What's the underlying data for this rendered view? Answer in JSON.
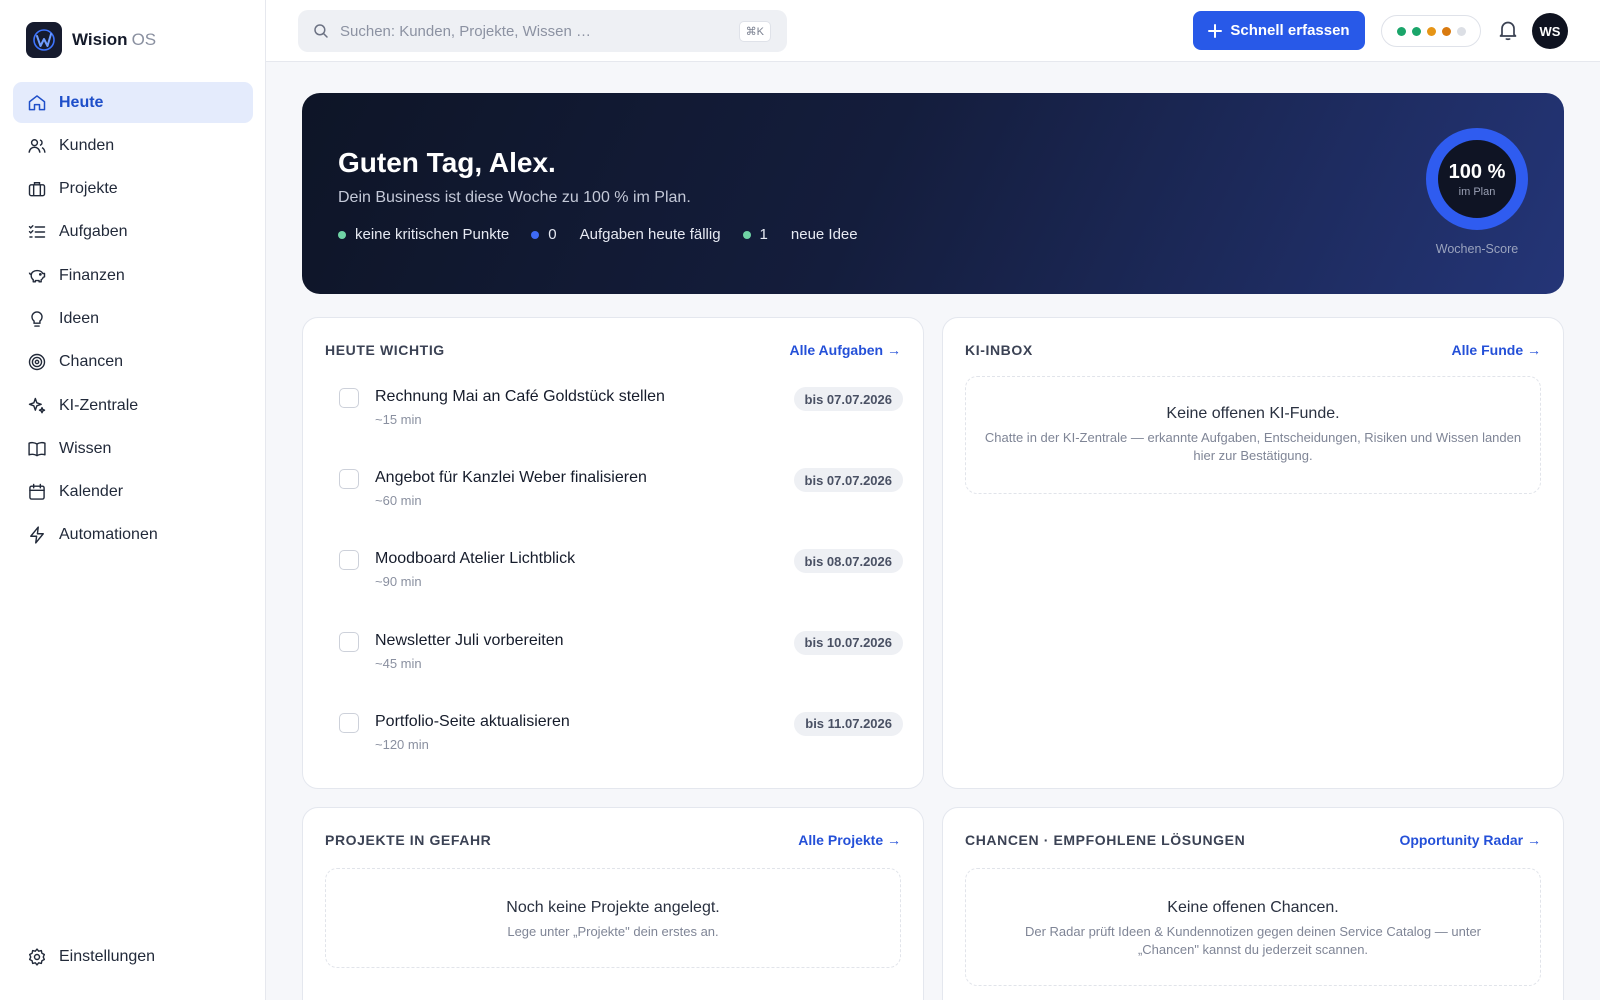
{
  "brand": {
    "name": "Wision",
    "suffix": "OS"
  },
  "sidebar": {
    "items": [
      {
        "label": "Heute",
        "icon": "home-icon",
        "active": true
      },
      {
        "label": "Kunden",
        "icon": "users-icon"
      },
      {
        "label": "Projekte",
        "icon": "briefcase-icon"
      },
      {
        "label": "Aufgaben",
        "icon": "checklist-icon"
      },
      {
        "label": "Finanzen",
        "icon": "piggy-bank-icon"
      },
      {
        "label": "Ideen",
        "icon": "lightbulb-icon"
      },
      {
        "label": "Chancen",
        "icon": "target-icon"
      },
      {
        "label": "KI-Zentrale",
        "icon": "sparkles-icon"
      },
      {
        "label": "Wissen",
        "icon": "book-icon"
      },
      {
        "label": "Kalender",
        "icon": "calendar-icon"
      },
      {
        "label": "Automationen",
        "icon": "lightning-icon"
      }
    ],
    "settings_label": "Einstellungen"
  },
  "topbar": {
    "search_placeholder": "Suchen: Kunden, Projekte, Wissen …",
    "search_shortcut": "⌘K",
    "quick_button": "Schnell erfassen",
    "status_dots": [
      "#1aa56a",
      "#1aa56a",
      "#e69516",
      "#d97a0f",
      "#dcdfe5"
    ],
    "avatar_initials": "WS"
  },
  "hero": {
    "title": "Guten Tag, Alex.",
    "subtitle": "Dein Business ist diese Woche zu 100 % im Plan.",
    "stat1": {
      "label": "keine kritischen Punkte",
      "color": "#6fd3a5"
    },
    "stat2": {
      "value": "0",
      "label": "Aufgaben heute fällig",
      "color": "#3e6af5"
    },
    "stat3": {
      "value": "1",
      "label": "neue Idee",
      "color": "#6fd3a5"
    },
    "score": {
      "value": "100 %",
      "sub": "im Plan",
      "caption": "Wochen-Score"
    }
  },
  "today": {
    "title": "HEUTE WICHTIG",
    "link": "Alle Aufgaben →",
    "tasks": [
      {
        "title": "Rechnung Mai an Café Goldstück stellen",
        "duration": "~15 min",
        "due": "bis 07.07.2026"
      },
      {
        "title": "Angebot für Kanzlei Weber finalisieren",
        "duration": "~60 min",
        "due": "bis 07.07.2026"
      },
      {
        "title": "Moodboard Atelier Lichtblick",
        "duration": "~90 min",
        "due": "bis 08.07.2026"
      },
      {
        "title": "Newsletter Juli vorbereiten",
        "duration": "~45 min",
        "due": "bis 10.07.2026"
      },
      {
        "title": "Portfolio-Seite aktualisieren",
        "duration": "~120 min",
        "due": "bis 11.07.2026"
      }
    ]
  },
  "inbox": {
    "title": "KI-INBOX",
    "link": "Alle Funde →",
    "empty_title": "Keine offenen KI-Funde.",
    "empty_sub": "Chatte in der KI-Zentrale — erkannte Aufgaben, Entscheidungen, Risiken und Wissen landen hier zur Bestätigung."
  },
  "projects": {
    "title": "PROJEKTE IN GEFAHR",
    "link": "Alle Projekte →",
    "empty_title": "Noch keine Projekte angelegt.",
    "empty_sub": "Lege unter „Projekte\" dein erstes an."
  },
  "chances": {
    "title": "CHANCEN · EMPFOHLENE LÖSUNGEN",
    "link": "Opportunity Radar →",
    "empty_title": "Keine offenen Chancen.",
    "empty_sub": "Der Radar prüft Ideen & Kundennotizen gegen deinen Service Catalog — unter „Chancen\" kannst du jederzeit scannen."
  }
}
